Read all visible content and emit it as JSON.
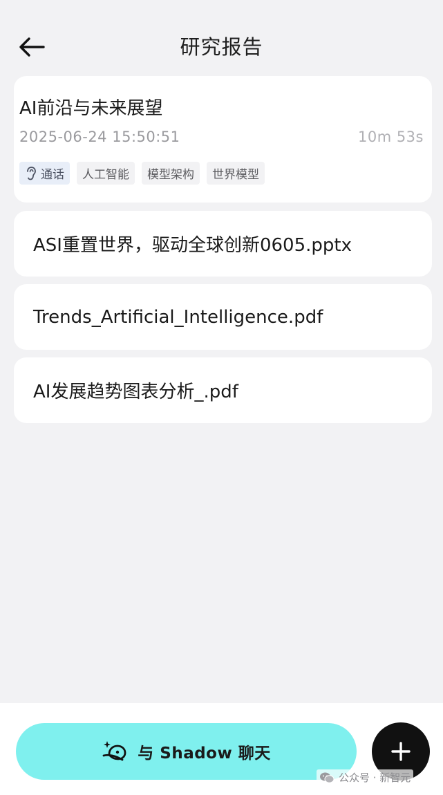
{
  "header": {
    "back_icon": "arrow-left-icon",
    "title": "研究报告"
  },
  "report": {
    "title": "AI前沿与未来展望",
    "datetime": "2025-06-24 15:50:51",
    "duration": "10m 53s",
    "tags": [
      {
        "label": "通话",
        "icon": "ear-icon"
      },
      {
        "label": "人工智能"
      },
      {
        "label": "模型架构"
      },
      {
        "label": "世界模型"
      }
    ]
  },
  "files": [
    {
      "name": "ASI重置世界，驱动全球创新0605.pptx"
    },
    {
      "name": "Trends_Artificial_Intelligence.pdf"
    },
    {
      "name": "AI发展趋势图表分析_.pdf"
    }
  ],
  "bottom": {
    "chat_label": "与 Shadow 聊天",
    "chat_icon": "sparkle-shadow-icon",
    "add_icon": "plus-icon",
    "accent": "#7ff0ee"
  },
  "watermark": {
    "text": "公众号 · 新智元",
    "icon": "wechat-icon"
  }
}
